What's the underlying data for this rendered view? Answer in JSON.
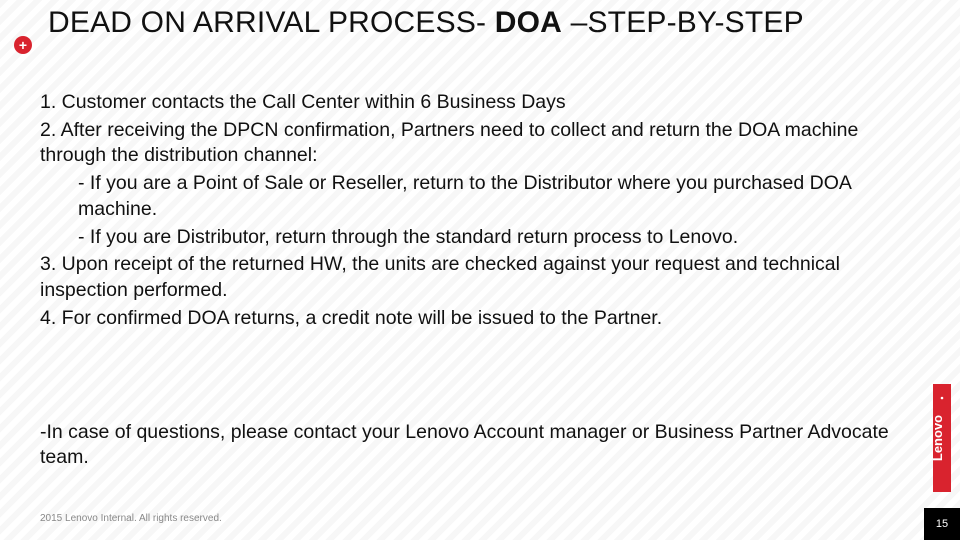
{
  "colors": {
    "accent": "#d9232e",
    "text": "#111111"
  },
  "badge": {
    "plus": "+"
  },
  "title": {
    "pre": "DEAD ON ARRIVAL PROCESS- ",
    "bold": "DOA",
    "post": " –STEP-BY-STEP"
  },
  "body": {
    "l1": "1.  Customer contacts the Call Center within 6 Business Days",
    "l2": "2.  After receiving the DPCN confirmation, Partners need to collect and return the DOA machine through the distribution channel:",
    "l3": "     - If you are a Point of Sale or Reseller, return to the Distributor where you purchased DOA machine.",
    "l4": "       - If you are Distributor, return through the standard return process to Lenovo.",
    "l5": " 3.  Upon receipt of the returned HW, the units are checked against your request and technical inspection performed.",
    "l6": " 4.  For confirmed DOA returns, a credit note will be issued to the Partner."
  },
  "note": "-In case of questions, please contact your Lenovo Account manager or Business Partner Advocate team.",
  "footer": "2015 Lenovo Internal. All rights reserved.",
  "page": "15",
  "brand": "Lenovo"
}
